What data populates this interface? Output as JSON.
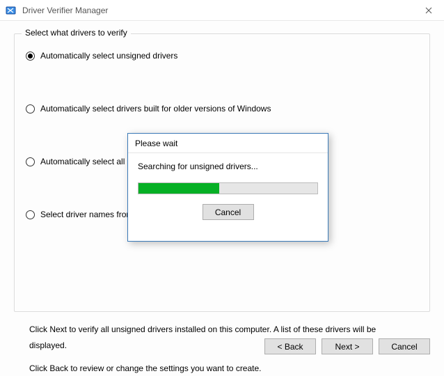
{
  "window": {
    "title": "Driver Verifier Manager"
  },
  "group": {
    "legend": "Select what drivers to verify",
    "options": [
      "Automatically select unsigned drivers",
      "Automatically select drivers built for older versions of Windows",
      "Automatically select all drivers installed on this computer",
      "Select driver names from a list"
    ],
    "selected_index": 0
  },
  "instructions": {
    "line1": "Click Next to verify all unsigned drivers installed on this computer. A list of these drivers will be displayed.",
    "line2": "Click Back to review or change the settings you want to create."
  },
  "footer": {
    "back": "< Back",
    "next": "Next >",
    "cancel": "Cancel"
  },
  "modal": {
    "title": "Please wait",
    "message": "Searching for unsigned drivers...",
    "progress_percent": 45,
    "cancel": "Cancel"
  }
}
